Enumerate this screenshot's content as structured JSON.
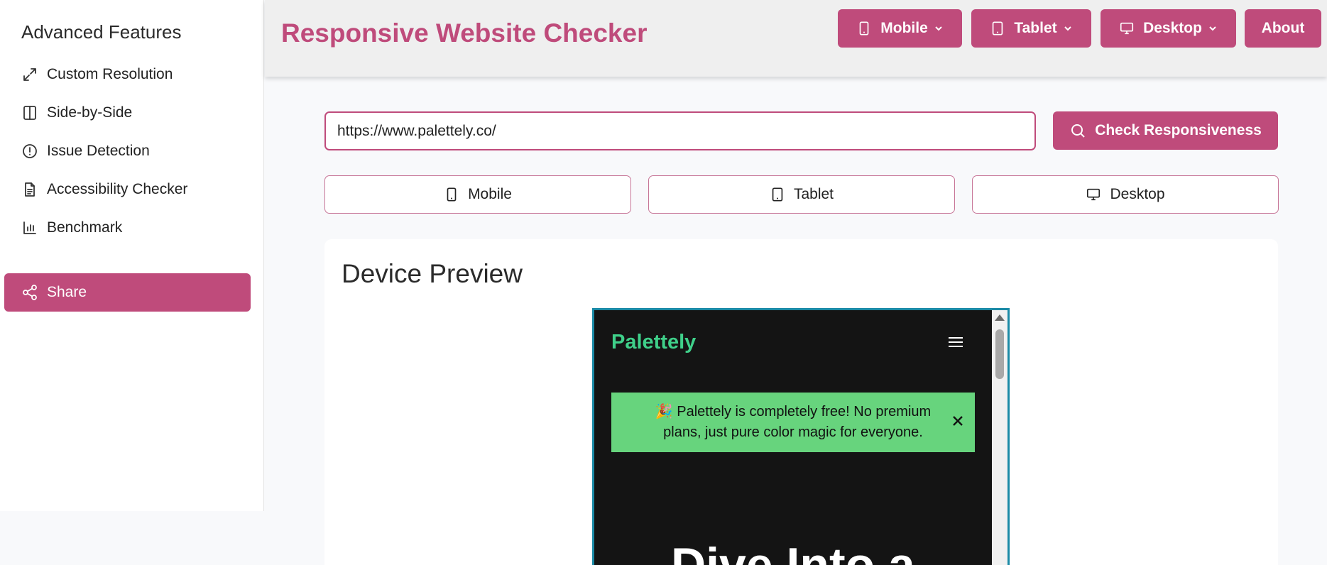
{
  "sidebar": {
    "title": "Advanced Features",
    "items": [
      {
        "label": "Custom Resolution",
        "icon": "expand-icon"
      },
      {
        "label": "Side-by-Side",
        "icon": "columns-icon"
      },
      {
        "label": "Issue Detection",
        "icon": "alert-circle-icon"
      },
      {
        "label": "Accessibility Checker",
        "icon": "document-icon"
      },
      {
        "label": "Benchmark",
        "icon": "bar-chart-icon"
      }
    ],
    "share_label": "Share"
  },
  "header": {
    "title": "Responsive Website Checker",
    "buttons": {
      "mobile": "Mobile",
      "tablet": "Tablet",
      "desktop": "Desktop",
      "about": "About"
    }
  },
  "search": {
    "url_value": "https://www.palettely.co/",
    "check_label": "Check Responsiveness"
  },
  "devices": {
    "mobile": "Mobile",
    "tablet": "Tablet",
    "desktop": "Desktop"
  },
  "preview": {
    "title": "Device Preview",
    "site": {
      "logo": "Palettely",
      "banner_text": "🎉 Palettely is completely free! No premium plans, just pure color magic for everyone.",
      "hero_text": "Dive Into a"
    }
  },
  "colors": {
    "accent": "#bf4b7b",
    "frame_border": "#1b8aa6",
    "site_logo": "#3fd08a",
    "banner_bg": "#67d47d"
  }
}
